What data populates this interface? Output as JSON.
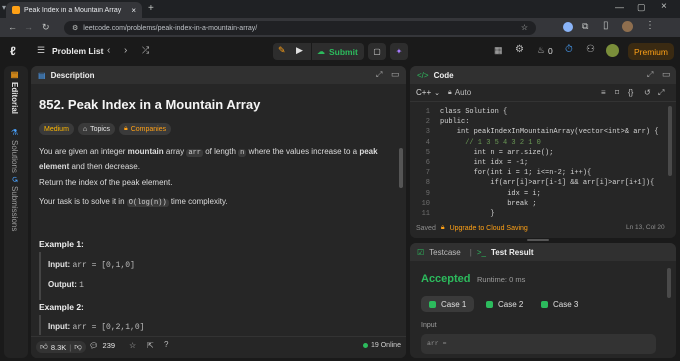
{
  "browser": {
    "tab_title": "Peak Index in a Mountain Array",
    "url": "leetcode.com/problems/peak-index-in-a-mountain-array/"
  },
  "nav": {
    "problem_list": "Problem List",
    "submit": "Submit",
    "streak": "0",
    "premium": "Premium"
  },
  "rail": {
    "editorial": "Editorial",
    "solutions": "Solutions",
    "submissions": "Submissions"
  },
  "description": {
    "tab": "Description",
    "title": "852. Peak Index in a Mountain Array",
    "difficulty": "Medium",
    "topics": "Topics",
    "companies": "Companies",
    "p1_a": "You are given an integer",
    "p1_b": "mountain",
    "p1_c": "array",
    "p1_arr": "arr",
    "p1_d": "of length",
    "p1_n": "n",
    "p1_e": "where the values increase to a",
    "p1_f": "peak",
    "p1_g": "element",
    "p1_h": "and then decrease.",
    "p2": "Return the index of the peak element.",
    "p3_a": "Your task is to solve it in",
    "p3_code": "O(log(n))",
    "p3_b": "time complexity.",
    "ex1_title": "Example 1:",
    "ex1_input_label": "Input:",
    "ex1_input_val": "arr = [0,1,0]",
    "ex1_output_label": "Output:",
    "ex1_output_val": "1",
    "ex2_title": "Example 2:",
    "ex2_input_label": "Input:",
    "ex2_input_val": "arr = [0,2,1,0]",
    "likes": "8.3K",
    "comments": "239",
    "online": "19 Online"
  },
  "code": {
    "tab": "Code",
    "language": "C++",
    "mode": "Auto",
    "lines": [
      {
        "n": "1",
        "text": "class Solution {"
      },
      {
        "n": "2",
        "text": "public:"
      },
      {
        "n": "3",
        "text": "    int peakIndexInMountainArray(vector<int>& arr) {"
      },
      {
        "n": "4",
        "text": "      // 1 3 5 4 3 2 1 0"
      },
      {
        "n": "5",
        "text": "        int n = arr.size();"
      },
      {
        "n": "6",
        "text": "        int idx = -1;"
      },
      {
        "n": "7",
        "text": "        for(int i = 1; i<=n-2; i++){"
      },
      {
        "n": "8",
        "text": "            if(arr[i]>arr[i-1] && arr[i]>arr[i+1]){"
      },
      {
        "n": "9",
        "text": "                idx = i;"
      },
      {
        "n": "10",
        "text": "                break ;"
      },
      {
        "n": "11",
        "text": "            }"
      }
    ],
    "saved": "Saved",
    "upgrade": "Upgrade to Cloud Saving",
    "cursor_pos": "Ln 13, Col 20"
  },
  "test": {
    "tab_testcase": "Testcase",
    "tab_result": "Test Result",
    "status": "Accepted",
    "runtime": "Runtime: 0 ms",
    "cases": [
      "Case 1",
      "Case 2",
      "Case 3"
    ],
    "input_label": "Input",
    "input_val": "arr ="
  },
  "colors": {
    "accepted": "#2cbb5d",
    "medium": "#ffb800",
    "submit": "#2cbb5d",
    "premium": "#ffa116"
  }
}
